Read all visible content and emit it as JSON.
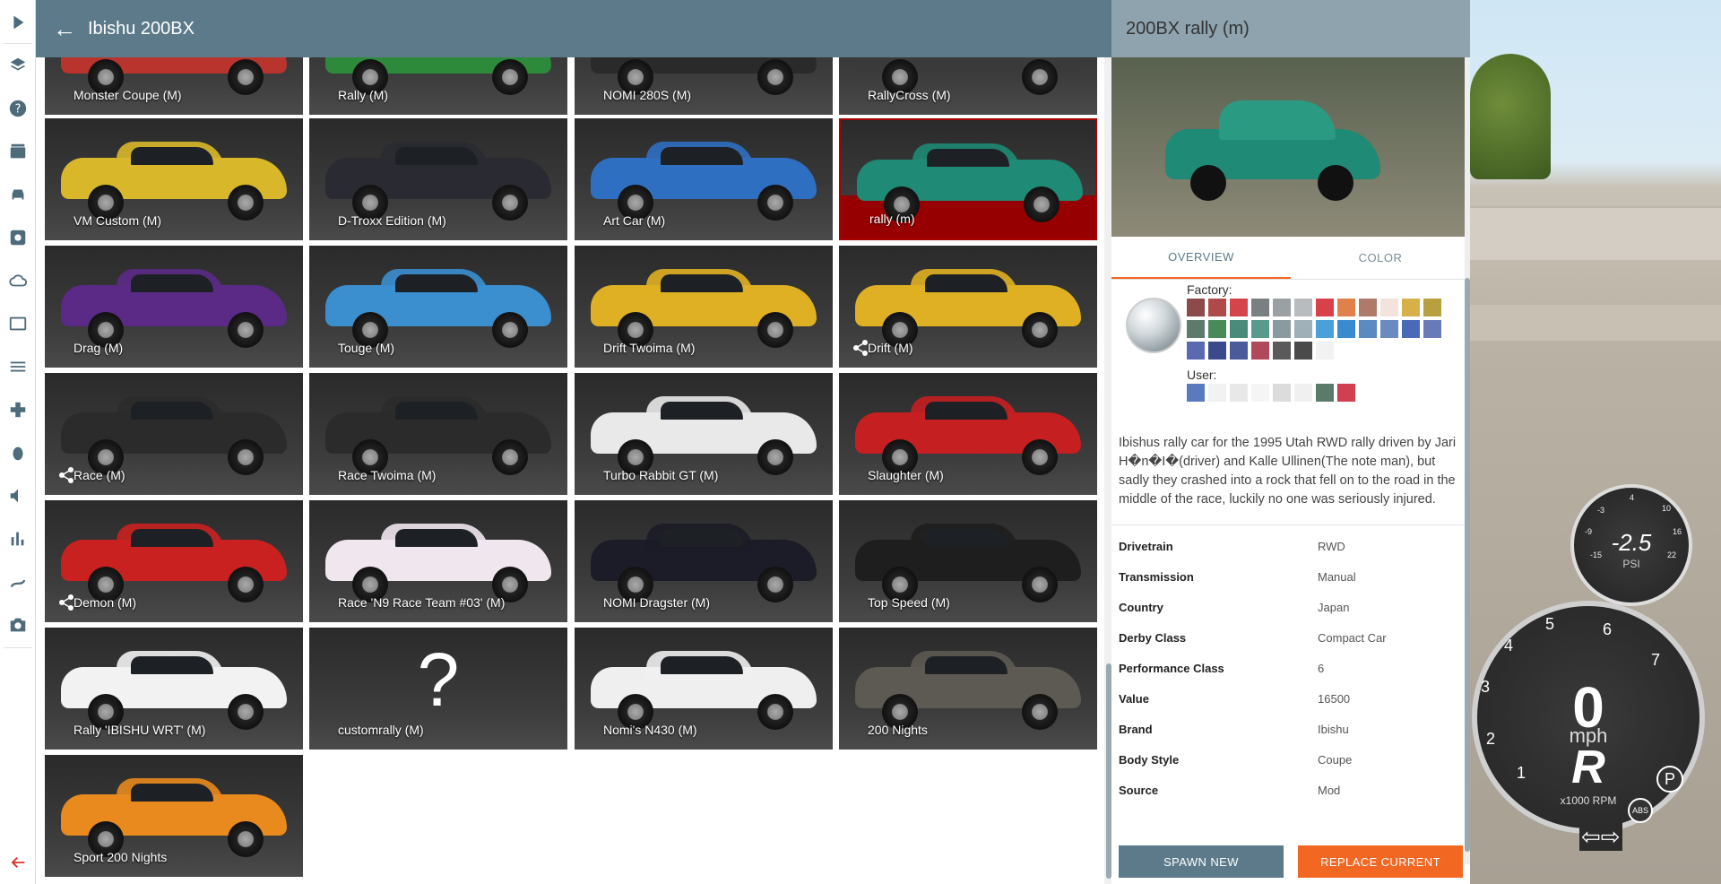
{
  "header": {
    "title": "Ibishu 200BX"
  },
  "rail": {
    "icons": [
      "play-icon",
      "layers-icon",
      "help-icon",
      "clapper-icon",
      "car-icon",
      "settings-icon",
      "cloud-icon",
      "dashboard-icon",
      "tune-icon",
      "gamepad-icon",
      "bug-icon",
      "volume-icon",
      "stats-icon",
      "route-icon",
      "camera-icon",
      "exit-arrow-icon"
    ]
  },
  "configs": [
    {
      "label": "Monster Coupe (M)",
      "color": "#b8342c",
      "share": false
    },
    {
      "label": "Rally (M)",
      "color": "#2c8a3a",
      "share": false
    },
    {
      "label": "NOMI 280S (M)",
      "color": "#2a2a2a",
      "share": false
    },
    {
      "label": "RallyCross (M)",
      "color": "#3a3a3a",
      "share": false
    },
    {
      "label": "VM Custom (M)",
      "color": "#d8b82a",
      "share": false
    },
    {
      "label": "D-Troxx Edition (M)",
      "color": "#2a2a32",
      "share": false
    },
    {
      "label": "Art Car (M)",
      "color": "#2f6fc2",
      "share": false
    },
    {
      "label": "rally (m)",
      "color": "#1f8a75",
      "share": false,
      "selected": true
    },
    {
      "label": "Drag (M)",
      "color": "#5b2a86",
      "share": false
    },
    {
      "label": "Touge (M)",
      "color": "#3b8fcf",
      "share": false
    },
    {
      "label": "Drift Twoima (M)",
      "color": "#e0b024",
      "share": false
    },
    {
      "label": "Drift (M)",
      "color": "#e0b024",
      "share": true
    },
    {
      "label": "Race (M)",
      "color": "#2b2b2b",
      "share": true
    },
    {
      "label": "Race Twoima (M)",
      "color": "#2b2b2b",
      "share": false
    },
    {
      "label": "Turbo Rabbit GT (M)",
      "color": "#e9e9e9",
      "share": false
    },
    {
      "label": "Slaughter (M)",
      "color": "#c51f22",
      "share": false
    },
    {
      "label": "Demon (M)",
      "color": "#c8211f",
      "share": true
    },
    {
      "label": "Race 'N9 Race Team #03' (M)",
      "color": "#f0e6ee",
      "share": false
    },
    {
      "label": "NOMI Dragster (M)",
      "color": "#1c1c28",
      "share": false
    },
    {
      "label": "Top Speed (M)",
      "color": "#1e1e1e",
      "share": false
    },
    {
      "label": "Rally 'IBISHU WRT' (M)",
      "color": "#f2f2f2",
      "share": false
    },
    {
      "label": "customrally (M)",
      "color": "",
      "share": false,
      "unknown": true,
      "glyph": "?"
    },
    {
      "label": "Nomi's N430 (M)",
      "color": "#efefef",
      "share": false
    },
    {
      "label": "200 Nights",
      "color": "#5c5a52",
      "share": false
    },
    {
      "label": "Sport 200 Nights",
      "color": "#e88a1e",
      "share": false
    }
  ],
  "panel": {
    "title": "200BX rally (m)",
    "tabs": [
      "OVERVIEW",
      "COLOR"
    ],
    "factory_label": "Factory:",
    "user_label": "User:",
    "factory_colors": [
      "#8c4a4a",
      "#b04a4a",
      "#d4444a",
      "#7a7f82",
      "#9aa0a3",
      "#b8bcbe",
      "#d8404a",
      "#e0804a",
      "#b07a6a",
      "#f2e4dc",
      "#d8b04a",
      "#b8a040",
      "#5e7a6a",
      "#4a8a5a",
      "#4a8a7a",
      "#5a9a8a",
      "#8a9aa0",
      "#a0b0b8",
      "#4aa0d8",
      "#3a8ad0",
      "#5a8ac0",
      "#6a8ac0",
      "#4a6ab8",
      "#6a7ab8",
      "#5a6ab0",
      "#3a4a8a",
      "#4a5a9a",
      "#b04a5a",
      "#5a5a5a",
      "#4a4a4a",
      "#f2f2f2"
    ],
    "user_colors": [
      "#5a7ac0",
      "#f2f2f2",
      "#e8e8e8",
      "#f5f5f5",
      "#dcdcdc",
      "#f0f0f0",
      "#5a7a6a",
      "#d04050"
    ],
    "description": "Ibishus rally car for the 1995 Utah RWD rally driven by Jari H�n�I�(driver) and Kalle Ullinen(The note man), but sadly they crashed into a rock that fell on to the road in the middle of the race, luckily no one was seriously injured.",
    "specs": [
      {
        "k": "Drivetrain",
        "v": "RWD"
      },
      {
        "k": "Transmission",
        "v": "Manual"
      },
      {
        "k": "Country",
        "v": "Japan"
      },
      {
        "k": "Derby Class",
        "v": "Compact Car"
      },
      {
        "k": "Performance Class",
        "v": "6"
      },
      {
        "k": "Value",
        "v": "16500"
      },
      {
        "k": "Brand",
        "v": "Ibishu"
      },
      {
        "k": "Body Style",
        "v": "Coupe"
      },
      {
        "k": "Source",
        "v": "Mod"
      }
    ],
    "spawn_label": "SPAWN NEW",
    "replace_label": "REPLACE CURRENT"
  },
  "hud": {
    "boost_value": "-2.5",
    "boost_unit": "PSI",
    "boost_ticks": [
      "-3",
      "4",
      "10",
      "-9",
      "16",
      "-15",
      "22"
    ],
    "speed": "0",
    "speed_unit": "mph",
    "gear": "R",
    "rpm_unit": "x1000 RPM",
    "rpm_ticks": [
      "1",
      "2",
      "3",
      "4",
      "5",
      "6",
      "7"
    ],
    "abs_label": "ABS",
    "park_label": "P"
  }
}
